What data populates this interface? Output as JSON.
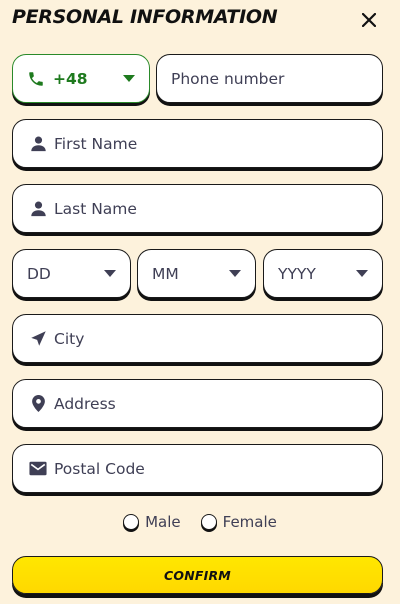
{
  "header": {
    "title": "PERSONAL INFORMATION",
    "close_icon": "close-icon"
  },
  "phone": {
    "code": "+48",
    "placeholder": "Phone number"
  },
  "fields": {
    "first_name": "First Name",
    "last_name": "Last Name",
    "city": "City",
    "address": "Address",
    "postal_code": "Postal Code"
  },
  "birthdate": {
    "day": "DD",
    "month": "MM",
    "year": "YYYY"
  },
  "gender": {
    "male": "Male",
    "female": "Female"
  },
  "confirm_label": "CONFIRM",
  "colors": {
    "background": "#fdf2dc",
    "accent_green": "#1e7a1e",
    "confirm_yellow": "#ffe100",
    "text": "#3f3f55"
  }
}
